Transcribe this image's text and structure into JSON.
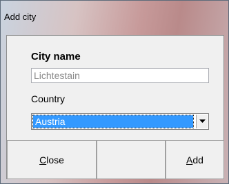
{
  "window": {
    "title": "Add city"
  },
  "form": {
    "city_label": "City name",
    "city_value": "Lichtestain",
    "country_label": "Country",
    "country_selected": "Austria"
  },
  "buttons": {
    "close_mnemonic": "C",
    "close_rest": "lose",
    "add_mnemonic": "A",
    "add_rest": "dd"
  },
  "icons": {
    "dropdown": "chevron-down-icon"
  },
  "colors": {
    "selection": "#3399ff",
    "dialog_bg": "#f0f0f0"
  }
}
